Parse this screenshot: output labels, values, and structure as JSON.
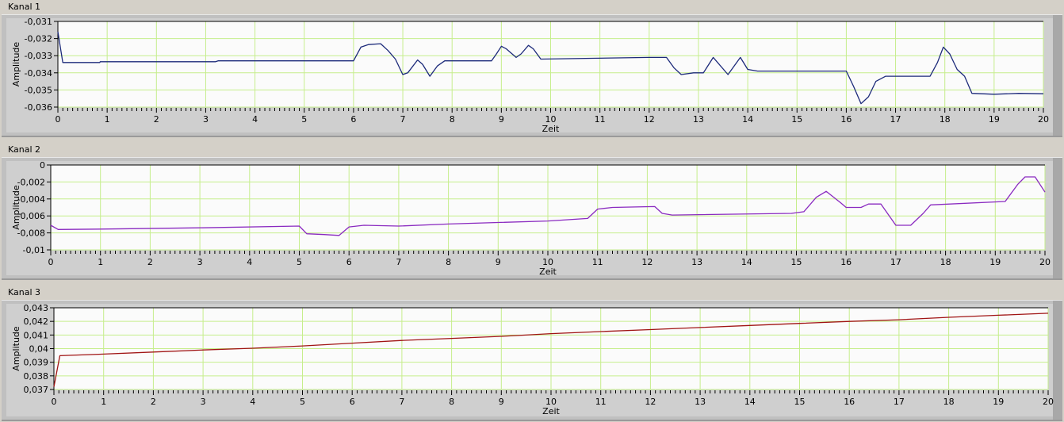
{
  "chart_data": [
    {
      "type": "line",
      "title": "Kanal 1",
      "xlabel": "Zeit",
      "ylabel": "Amplitude",
      "xlim": [
        0,
        20
      ],
      "ylim": [
        -0.036,
        -0.031
      ],
      "xticks": [
        "0",
        "1",
        "2",
        "3",
        "4",
        "5",
        "6",
        "7",
        "8",
        "9",
        "10",
        "11",
        "12",
        "13",
        "14",
        "15",
        "16",
        "17",
        "18",
        "19",
        "20"
      ],
      "yticks": [
        "-0,031",
        "-0,032",
        "-0,033",
        "-0,034",
        "-0,035",
        "-0,036"
      ],
      "grid": true,
      "color": "#1c2a7a",
      "series": [
        {
          "name": "Kanal 1",
          "points": [
            [
              0,
              -0.0316
            ],
            [
              0.1,
              -0.0334
            ],
            [
              0.85,
              -0.0334
            ],
            [
              0.86,
              -0.03335
            ],
            [
              3.2,
              -0.03335
            ],
            [
              3.25,
              -0.0333
            ],
            [
              6.0,
              -0.0333
            ],
            [
              6.15,
              -0.0325
            ],
            [
              6.3,
              -0.03235
            ],
            [
              6.55,
              -0.0323
            ],
            [
              6.7,
              -0.0327
            ],
            [
              6.85,
              -0.0332
            ],
            [
              7.0,
              -0.0341
            ],
            [
              7.1,
              -0.034
            ],
            [
              7.3,
              -0.03325
            ],
            [
              7.4,
              -0.0335
            ],
            [
              7.55,
              -0.0342
            ],
            [
              7.7,
              -0.0336
            ],
            [
              7.85,
              -0.0333
            ],
            [
              8.8,
              -0.0333
            ],
            [
              8.9,
              -0.0329
            ],
            [
              9.0,
              -0.03245
            ],
            [
              9.1,
              -0.0326
            ],
            [
              9.3,
              -0.0331
            ],
            [
              9.4,
              -0.0329
            ],
            [
              9.55,
              -0.0324
            ],
            [
              9.65,
              -0.0326
            ],
            [
              9.8,
              -0.0332
            ],
            [
              12.0,
              -0.0331
            ],
            [
              12.35,
              -0.0331
            ],
            [
              12.5,
              -0.0337
            ],
            [
              12.65,
              -0.0341
            ],
            [
              12.9,
              -0.034
            ],
            [
              13.1,
              -0.034
            ],
            [
              13.3,
              -0.0331
            ],
            [
              13.6,
              -0.0341
            ],
            [
              13.85,
              -0.0331
            ],
            [
              14.0,
              -0.0338
            ],
            [
              14.2,
              -0.0339
            ],
            [
              16.0,
              -0.0339
            ],
            [
              16.15,
              -0.0348
            ],
            [
              16.3,
              -0.0358
            ],
            [
              16.45,
              -0.0354
            ],
            [
              16.6,
              -0.0345
            ],
            [
              16.8,
              -0.0342
            ],
            [
              17.7,
              -0.0342
            ],
            [
              17.85,
              -0.0334
            ],
            [
              17.97,
              -0.0325
            ],
            [
              18.1,
              -0.0329
            ],
            [
              18.25,
              -0.0338
            ],
            [
              18.4,
              -0.0342
            ],
            [
              18.55,
              -0.0352
            ],
            [
              19.0,
              -0.03525
            ],
            [
              19.5,
              -0.0352
            ],
            [
              20,
              -0.03522
            ]
          ]
        }
      ]
    },
    {
      "type": "line",
      "title": "Kanal 2",
      "xlabel": "Zeit",
      "ylabel": "Amplitude",
      "xlim": [
        0,
        20
      ],
      "ylim": [
        -0.01,
        0
      ],
      "xticks": [
        "0",
        "1",
        "2",
        "3",
        "4",
        "5",
        "6",
        "7",
        "8",
        "9",
        "10",
        "11",
        "12",
        "13",
        "14",
        "15",
        "16",
        "17",
        "18",
        "19",
        "20"
      ],
      "yticks": [
        "0",
        "-0,002",
        "-0,004",
        "-0,006",
        "-0,008",
        "-0,01"
      ],
      "grid": true,
      "color": "#8a2ac0",
      "series": [
        {
          "name": "Kanal 2",
          "points": [
            [
              0,
              -0.0071
            ],
            [
              0.15,
              -0.0076
            ],
            [
              1.0,
              -0.00755
            ],
            [
              3,
              -0.0074
            ],
            [
              5,
              -0.0072
            ],
            [
              5.15,
              -0.0081
            ],
            [
              5.5,
              -0.0082
            ],
            [
              5.8,
              -0.0083
            ],
            [
              6.0,
              -0.0073
            ],
            [
              6.3,
              -0.0071
            ],
            [
              7,
              -0.0072
            ],
            [
              8,
              -0.00695
            ],
            [
              10,
              -0.0066
            ],
            [
              10.8,
              -0.0063
            ],
            [
              11.0,
              -0.0052
            ],
            [
              11.3,
              -0.005
            ],
            [
              12.15,
              -0.0049
            ],
            [
              12.3,
              -0.0057
            ],
            [
              12.5,
              -0.0059
            ],
            [
              14.9,
              -0.0057
            ],
            [
              15.15,
              -0.0055
            ],
            [
              15.4,
              -0.0038
            ],
            [
              15.6,
              -0.0031
            ],
            [
              15.9,
              -0.0045
            ],
            [
              16.0,
              -0.005
            ],
            [
              16.3,
              -0.005
            ],
            [
              16.45,
              -0.0046
            ],
            [
              16.7,
              -0.0046
            ],
            [
              17.0,
              -0.0071
            ],
            [
              17.3,
              -0.0071
            ],
            [
              17.55,
              -0.0057
            ],
            [
              17.7,
              -0.0047
            ],
            [
              19.2,
              -0.0043
            ],
            [
              19.45,
              -0.0023
            ],
            [
              19.6,
              -0.0014
            ],
            [
              19.8,
              -0.0014
            ],
            [
              20,
              -0.0032
            ]
          ]
        }
      ]
    },
    {
      "type": "line",
      "title": "Kanal 3",
      "xlabel": "Zeit",
      "ylabel": "Amplitude",
      "xlim": [
        0,
        20
      ],
      "ylim": [
        0.037,
        0.043
      ],
      "xticks": [
        "0",
        "1",
        "2",
        "3",
        "4",
        "5",
        "6",
        "7",
        "8",
        "9",
        "10",
        "11",
        "12",
        "13",
        "14",
        "15",
        "16",
        "17",
        "18",
        "19",
        "20"
      ],
      "yticks": [
        "0,043",
        "0,042",
        "0,041",
        "0,04",
        "0,039",
        "0,038",
        "0,037"
      ],
      "grid": true,
      "color": "#a01414",
      "series": [
        {
          "name": "Kanal 3",
          "points": [
            [
              0,
              0.0372
            ],
            [
              0.12,
              0.03948
            ],
            [
              1,
              0.0396
            ],
            [
              2,
              0.03975
            ],
            [
              3,
              0.0399
            ],
            [
              4,
              0.04003
            ],
            [
              5,
              0.0402
            ],
            [
              6,
              0.0404
            ],
            [
              7,
              0.0406
            ],
            [
              8,
              0.04075
            ],
            [
              9,
              0.0409
            ],
            [
              10,
              0.0411
            ],
            [
              11,
              0.04125
            ],
            [
              12,
              0.0414
            ],
            [
              13,
              0.04155
            ],
            [
              14,
              0.0417
            ],
            [
              15,
              0.04185
            ],
            [
              16,
              0.042
            ],
            [
              17,
              0.04212
            ],
            [
              18,
              0.0423
            ],
            [
              19,
              0.04245
            ],
            [
              20,
              0.0426
            ]
          ]
        }
      ]
    }
  ]
}
